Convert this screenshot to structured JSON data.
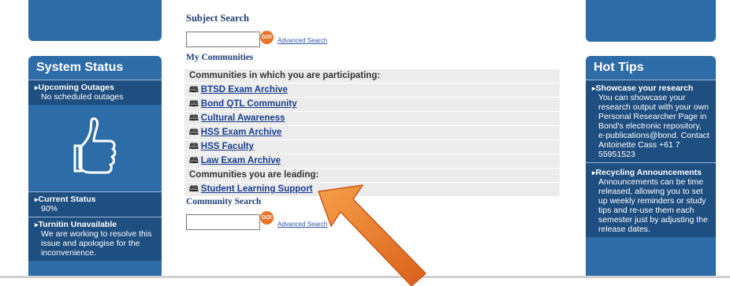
{
  "left_panel": {
    "title": "System Status",
    "outages": {
      "head": "Upcoming Outages",
      "body": "No scheduled outages"
    },
    "current": {
      "head": "Current Status",
      "body": "90%"
    },
    "turnitin": {
      "head": "Turnitin Unavailable",
      "body": "We are working to resolve this issue and apologise for the inconvenience."
    },
    "icon": "thumbs-up-icon"
  },
  "center": {
    "subject_search": {
      "title": "Subject Search",
      "go": "GO!",
      "advanced": "Advanced Search",
      "value": ""
    },
    "my_communities": {
      "title": "My Communities",
      "participating_label": "Communities in which you are participating:",
      "participating": [
        "BTSD Exam Archive",
        "Bond QTL Community",
        "Cultural Awareness",
        "HSS Exam Archive",
        "HSS Faculty",
        "Law Exam Archive"
      ],
      "leading_label": "Communities you are leading:",
      "leading": [
        "Student Learning Support"
      ]
    },
    "community_search": {
      "title": "Community Search",
      "go": "GO!",
      "advanced": "Advanced Search",
      "value": ""
    }
  },
  "right_panel": {
    "title": "Hot Tips",
    "tip1": {
      "head": "Showcase your research",
      "body": "You can showcase your research output with your own Personal Researcher Page in Bond's electronic repository, e-publications@bond. Contact Antoinette Cass +61 7 55951523"
    },
    "tip2": {
      "head": "Recycling Announcements",
      "body": "Announcements can be time released, allowing you to set up weekly reminders or study tips and re-use them each semester just by adjusting the release dates."
    }
  },
  "colors": {
    "panel": "#2e6ca8",
    "arrow": "#e8731e",
    "heading": "#1f3f73"
  }
}
